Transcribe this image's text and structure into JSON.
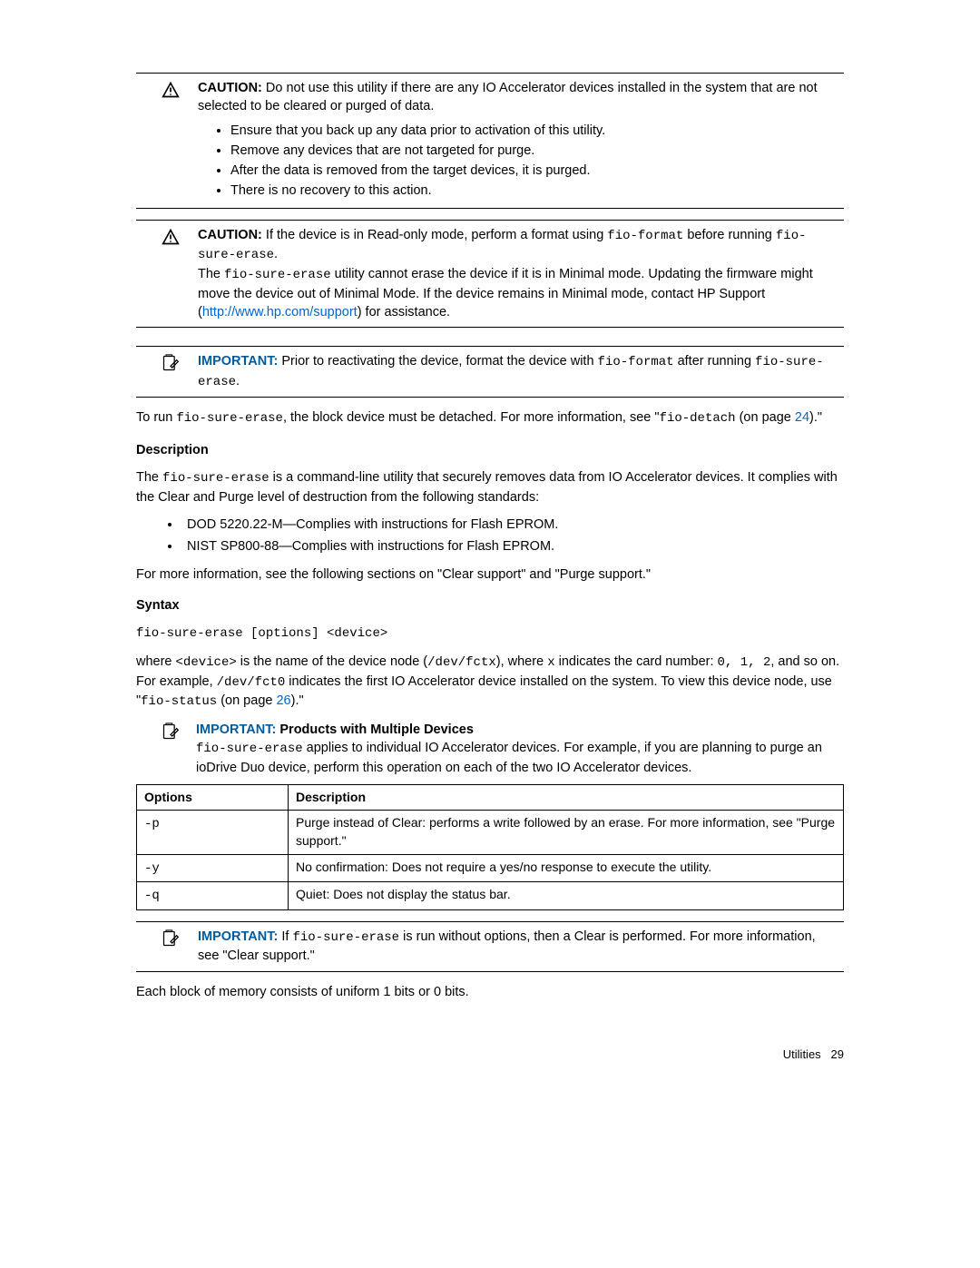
{
  "caution1": {
    "label": "CAUTION:",
    "text": "Do not use this utility if there are any IO Accelerator devices installed in the system that are not selected to be cleared or purged of data.",
    "bullets": [
      "Ensure that you back up any data prior to activation of this utility.",
      "Remove any devices that are not targeted for purge.",
      "After the data is removed from the target devices, it is purged.",
      "There is no recovery to this action."
    ]
  },
  "caution2": {
    "label": "CAUTION:",
    "pre1": "If the device is in Read-only mode, perform a format using ",
    "code1": "fio-format",
    "mid1": " before running ",
    "code2": "fio-sure-erase",
    "post1": ".",
    "line2a": "The ",
    "line2code": "fio-sure-erase",
    "line2b": " utility cannot erase the device if it is in Minimal mode. Updating the firmware might move the device out of Minimal Mode. If the device remains in Minimal mode, contact HP Support (",
    "url": "http://www.hp.com/support",
    "line2c": ") for assistance."
  },
  "important1": {
    "label": "IMPORTANT:",
    "pre": "Prior to reactivating the device, format the device with ",
    "code1": "fio-format",
    "mid": " after running ",
    "code2": "fio-sure-erase",
    "post": "."
  },
  "body": {
    "run_pre": "To run ",
    "run_code": "fio-sure-erase",
    "run_mid": ", the block device must be detached. For more information, see \"",
    "run_code2": "fio-detach",
    "run_post": " (on page ",
    "run_page": "24",
    "run_close": ").\"",
    "desc_heading": "Description",
    "desc_para_pre": "The ",
    "desc_para_code": "fio-sure-erase",
    "desc_para_post": " is a command-line utility that securely removes data from IO Accelerator devices. It complies with the Clear and Purge level of destruction from the following standards:",
    "standards": [
      "DOD 5220.22-M—Complies with instructions for Flash EPROM.",
      "NIST SP800-88—Complies with instructions for Flash EPROM."
    ],
    "desc_after": "For more information, see the following sections on \"Clear support\" and \"Purge support.\"",
    "syntax_heading": "Syntax",
    "syntax_code": "fio-sure-erase [options] <device>",
    "where_pre": "where ",
    "where_c1": "<device>",
    "where_mid1": " is the name of the device node (",
    "where_c2": "/dev/fctx",
    "where_mid2": "), where ",
    "where_c3": "x",
    "where_mid3": " indicates the card number: ",
    "where_c4": "0, 1, 2",
    "where_mid4": ", and so on. For example, ",
    "where_c5": "/dev/fct0",
    "where_mid5": " indicates the first IO Accelerator device installed on the system. To view this device node, use \"",
    "where_c6": "fio-status",
    "where_mid6": " (on page ",
    "where_page": "26",
    "where_close": ").\""
  },
  "important_multi": {
    "label": "IMPORTANT:",
    "heading": "Products with Multiple Devices",
    "pre": "",
    "code": "fio-sure-erase",
    "text": " applies to individual IO Accelerator devices. For example, if you are planning to purge an ioDrive Duo device, perform this operation on each of the two IO Accelerator devices."
  },
  "table": {
    "h1": "Options",
    "h2": "Description",
    "rows": [
      {
        "opt": "-p",
        "desc": "Purge instead of Clear: performs a write followed by an erase. For more information, see \"Purge support.\""
      },
      {
        "opt": "-y",
        "desc": "No confirmation: Does not require a yes/no response to execute the utility."
      },
      {
        "opt": "-q",
        "desc": "Quiet: Does not display the status bar."
      }
    ]
  },
  "important3": {
    "label": "IMPORTANT:",
    "pre": "If ",
    "code": "fio-sure-erase",
    "post": " is run without options, then a Clear is performed. For more information, see \"Clear support.\""
  },
  "closing": "Each block of memory consists of uniform 1 bits or 0 bits.",
  "footer": {
    "section": "Utilities",
    "page": "29"
  }
}
